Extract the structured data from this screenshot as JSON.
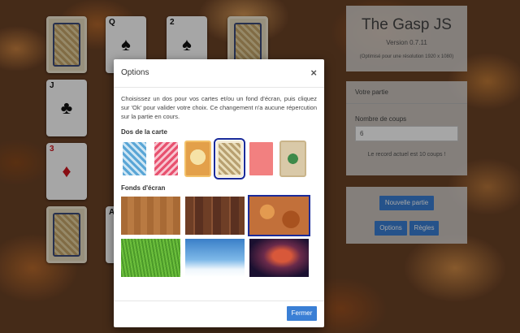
{
  "app": {
    "title": "The Gasp JS",
    "version": "Version 0.7.11",
    "optimized_note": "(Optimisé pour une résolution 1920 x 1080)"
  },
  "game_panel": {
    "header": "Votre partie",
    "moves_label": "Nombre de coups",
    "moves_value": "6",
    "record_text": "Le record actuel est 10 coups !"
  },
  "buttons": {
    "new_game": "Nouvelle partie",
    "options": "Options",
    "rules": "Règles"
  },
  "modal": {
    "title": "Options",
    "close_symbol": "×",
    "intro": "Choisissez un dos pour vos cartes et/ou un fond d'écran, puis cliquez sur 'Ok' pour valider votre choix. Ce changement n'a aucune répercution sur la partie en cours.",
    "backs_heading": "Dos de la carte",
    "wallpapers_heading": "Fonds d'écran",
    "close_button": "Fermer",
    "card_backs": [
      {
        "name": "blue-ornate-back",
        "color": "#5aa6d6",
        "selected": false
      },
      {
        "name": "pink-ornate-back",
        "color": "#e8516f",
        "selected": false
      },
      {
        "name": "vintage-illustration-back",
        "color": "#e3a04a",
        "selected": false
      },
      {
        "name": "gold-filigree-back",
        "color": "#b8a070",
        "selected": true
      },
      {
        "name": "plain-coral-back",
        "color": "#f28080",
        "selected": false
      },
      {
        "name": "rose-emblem-back",
        "color": "#d9c9a8",
        "selected": false
      }
    ],
    "wallpapers": [
      {
        "name": "wood-apple-wallpaper",
        "color": "#a86a35",
        "selected": false
      },
      {
        "name": "dark-wood-planks-wallpaper",
        "color": "#6e3e26",
        "selected": false
      },
      {
        "name": "autumn-leaves-wallpaper",
        "color": "#c2703a",
        "selected": true
      },
      {
        "name": "green-grass-wallpaper",
        "color": "#4c9a2a",
        "selected": false
      },
      {
        "name": "blue-sky-clouds-wallpaper",
        "color": "#5b9fd8",
        "selected": false
      },
      {
        "name": "nebula-space-wallpaper",
        "color": "#3a2a5a",
        "selected": false
      }
    ]
  },
  "table_cards": [
    {
      "rank": "",
      "suit": "",
      "face": "back"
    },
    {
      "rank": "Q",
      "suit": "♠",
      "face": "up",
      "color": "black"
    },
    {
      "rank": "2",
      "suit": "♠",
      "face": "up",
      "color": "black"
    },
    {
      "rank": "",
      "suit": "",
      "face": "back"
    },
    {
      "rank": "J",
      "suit": "♣",
      "face": "up",
      "color": "black"
    },
    {
      "rank": "3",
      "suit": "♦",
      "face": "up",
      "color": "red"
    },
    {
      "rank": "",
      "suit": "",
      "face": "back"
    },
    {
      "rank": "A",
      "suit": "♣",
      "face": "up",
      "color": "black"
    }
  ]
}
